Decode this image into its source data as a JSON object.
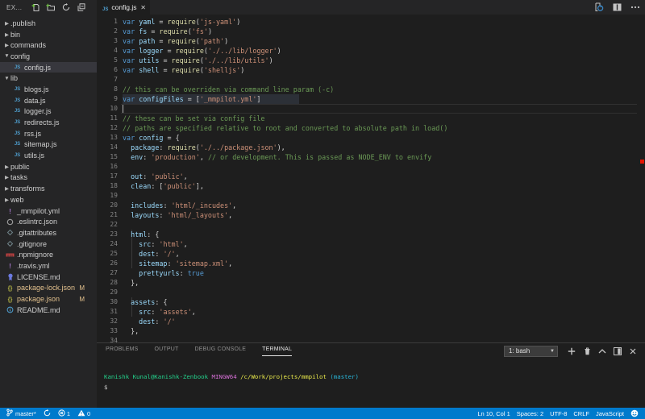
{
  "sidebar": {
    "title": "EX...",
    "actions": [
      {
        "name": "new-file",
        "icon": "new-file-icon"
      },
      {
        "name": "new-folder",
        "icon": "new-folder-icon"
      },
      {
        "name": "refresh",
        "icon": "refresh-icon"
      },
      {
        "name": "collapse-all",
        "icon": "collapse-all-icon"
      }
    ],
    "items": [
      {
        "label": ".publish",
        "kind": "folder",
        "state": "collapsed"
      },
      {
        "label": "bin",
        "kind": "folder",
        "state": "collapsed"
      },
      {
        "label": "commands",
        "kind": "folder",
        "state": "collapsed"
      },
      {
        "label": "config",
        "kind": "folder",
        "state": "expanded"
      },
      {
        "label": "config.js",
        "kind": "file",
        "icon": "js",
        "indent": 1,
        "selected": true
      },
      {
        "label": "lib",
        "kind": "folder",
        "state": "expanded"
      },
      {
        "label": "blogs.js",
        "kind": "file",
        "icon": "js",
        "indent": 1
      },
      {
        "label": "data.js",
        "kind": "file",
        "icon": "js",
        "indent": 1
      },
      {
        "label": "logger.js",
        "kind": "file",
        "icon": "js",
        "indent": 1
      },
      {
        "label": "redirects.js",
        "kind": "file",
        "icon": "js",
        "indent": 1
      },
      {
        "label": "rss.js",
        "kind": "file",
        "icon": "js",
        "indent": 1
      },
      {
        "label": "sitemap.js",
        "kind": "file",
        "icon": "js",
        "indent": 1
      },
      {
        "label": "utils.js",
        "kind": "file",
        "icon": "js",
        "indent": 1
      },
      {
        "label": "public",
        "kind": "folder",
        "state": "collapsed"
      },
      {
        "label": "tasks",
        "kind": "folder",
        "state": "collapsed"
      },
      {
        "label": "transforms",
        "kind": "folder",
        "state": "collapsed"
      },
      {
        "label": "web",
        "kind": "folder",
        "state": "collapsed"
      },
      {
        "label": "_mmpilot.yml",
        "kind": "file",
        "icon": "yml"
      },
      {
        "label": ".eslintrc.json",
        "kind": "file",
        "icon": "eslint"
      },
      {
        "label": ".gitattributes",
        "kind": "file",
        "icon": "git"
      },
      {
        "label": ".gitignore",
        "kind": "file",
        "icon": "git"
      },
      {
        "label": ".npmignore",
        "kind": "file",
        "icon": "npm"
      },
      {
        "label": ".travis.yml",
        "kind": "file",
        "icon": "yml"
      },
      {
        "label": "LICENSE.md",
        "kind": "file",
        "icon": "license"
      },
      {
        "label": "package-lock.json",
        "kind": "file",
        "icon": "json",
        "badge": "M",
        "modified": true
      },
      {
        "label": "package.json",
        "kind": "file",
        "icon": "json",
        "badge": "M",
        "modified": true
      },
      {
        "label": "README.md",
        "kind": "file",
        "icon": "info"
      }
    ]
  },
  "editor": {
    "tab": {
      "label": "config.js",
      "icon": "js",
      "close": "✕"
    },
    "actions": [
      {
        "name": "open-changes",
        "icon": "open-changes-icon"
      },
      {
        "name": "split-editor",
        "icon": "split-editor-icon"
      },
      {
        "name": "more-actions",
        "icon": "ellipsis-icon"
      }
    ],
    "cursor": {
      "line": 10,
      "col": 1
    },
    "code_lines": [
      {
        "n": 1,
        "tokens": [
          [
            "k",
            "var"
          ],
          [
            "p",
            " "
          ],
          [
            "v",
            "yaml"
          ],
          [
            "p",
            " = "
          ],
          [
            "f",
            "require"
          ],
          [
            "p",
            "("
          ],
          [
            "s",
            "'js-yaml'"
          ],
          [
            "p",
            ")"
          ]
        ]
      },
      {
        "n": 2,
        "tokens": [
          [
            "k",
            "var"
          ],
          [
            "p",
            " "
          ],
          [
            "v",
            "fs"
          ],
          [
            "p",
            " = "
          ],
          [
            "f",
            "require"
          ],
          [
            "p",
            "("
          ],
          [
            "s",
            "'fs'"
          ],
          [
            "p",
            ")"
          ]
        ]
      },
      {
        "n": 3,
        "tokens": [
          [
            "k",
            "var"
          ],
          [
            "p",
            " "
          ],
          [
            "v",
            "path"
          ],
          [
            "p",
            " = "
          ],
          [
            "f",
            "require"
          ],
          [
            "p",
            "("
          ],
          [
            "s",
            "'path'"
          ],
          [
            "p",
            ")"
          ]
        ]
      },
      {
        "n": 4,
        "tokens": [
          [
            "k",
            "var"
          ],
          [
            "p",
            " "
          ],
          [
            "v",
            "logger"
          ],
          [
            "p",
            " = "
          ],
          [
            "f",
            "require"
          ],
          [
            "p",
            "("
          ],
          [
            "s",
            "'./../lib/logger'"
          ],
          [
            "p",
            ")"
          ]
        ]
      },
      {
        "n": 5,
        "tokens": [
          [
            "k",
            "var"
          ],
          [
            "p",
            " "
          ],
          [
            "v",
            "utils"
          ],
          [
            "p",
            " = "
          ],
          [
            "f",
            "require"
          ],
          [
            "p",
            "("
          ],
          [
            "s",
            "'./../lib/utils'"
          ],
          [
            "p",
            ")"
          ]
        ]
      },
      {
        "n": 6,
        "tokens": [
          [
            "k",
            "var"
          ],
          [
            "p",
            " "
          ],
          [
            "v",
            "shell"
          ],
          [
            "p",
            " = "
          ],
          [
            "f",
            "require"
          ],
          [
            "p",
            "("
          ],
          [
            "s",
            "'shelljs'"
          ],
          [
            "p",
            ")"
          ]
        ]
      },
      {
        "n": 7,
        "tokens": []
      },
      {
        "n": 8,
        "tokens": [
          [
            "c",
            "// this can be overriden via command line param (-c)"
          ]
        ]
      },
      {
        "n": 9,
        "tokens": [
          [
            "k",
            "var"
          ],
          [
            "p",
            " "
          ],
          [
            "v",
            "configFiles"
          ],
          [
            "p",
            " = ["
          ],
          [
            "s",
            "'_mmpilot.yml'"
          ],
          [
            "p",
            "]"
          ]
        ]
      },
      {
        "n": 10,
        "tokens": []
      },
      {
        "n": 11,
        "tokens": [
          [
            "c",
            "// these can be set via config file"
          ]
        ]
      },
      {
        "n": 12,
        "tokens": [
          [
            "c",
            "// paths are specified relative to root and converted to absolute path in load()"
          ]
        ]
      },
      {
        "n": 13,
        "tokens": [
          [
            "k",
            "var"
          ],
          [
            "p",
            " "
          ],
          [
            "v",
            "config"
          ],
          [
            "p",
            " = {"
          ]
        ]
      },
      {
        "n": 14,
        "tokens": [
          [
            "p",
            "  "
          ],
          [
            "v",
            "package"
          ],
          [
            "p",
            ": "
          ],
          [
            "f",
            "require"
          ],
          [
            "p",
            "("
          ],
          [
            "s",
            "'./../package.json'"
          ],
          [
            "p",
            "),"
          ]
        ]
      },
      {
        "n": 15,
        "tokens": [
          [
            "p",
            "  "
          ],
          [
            "v",
            "env"
          ],
          [
            "p",
            ": "
          ],
          [
            "s",
            "'production'"
          ],
          [
            "p",
            ", "
          ],
          [
            "c",
            "// or development. This is passed as NODE_ENV to envify"
          ]
        ]
      },
      {
        "n": 16,
        "tokens": []
      },
      {
        "n": 17,
        "tokens": [
          [
            "p",
            "  "
          ],
          [
            "v",
            "out"
          ],
          [
            "p",
            ": "
          ],
          [
            "s",
            "'public'"
          ],
          [
            "p",
            ","
          ]
        ]
      },
      {
        "n": 18,
        "tokens": [
          [
            "p",
            "  "
          ],
          [
            "v",
            "clean"
          ],
          [
            "p",
            ": ["
          ],
          [
            "s",
            "'public'"
          ],
          [
            "p",
            "],"
          ]
        ]
      },
      {
        "n": 19,
        "tokens": []
      },
      {
        "n": 20,
        "tokens": [
          [
            "p",
            "  "
          ],
          [
            "v",
            "includes"
          ],
          [
            "p",
            ": "
          ],
          [
            "s",
            "'html/_incudes'"
          ],
          [
            "p",
            ","
          ]
        ]
      },
      {
        "n": 21,
        "tokens": [
          [
            "p",
            "  "
          ],
          [
            "v",
            "layouts"
          ],
          [
            "p",
            ": "
          ],
          [
            "s",
            "'html/_layouts'"
          ],
          [
            "p",
            ","
          ]
        ]
      },
      {
        "n": 22,
        "tokens": []
      },
      {
        "n": 23,
        "tokens": [
          [
            "p",
            "  "
          ],
          [
            "v",
            "html"
          ],
          [
            "p",
            ": {"
          ]
        ]
      },
      {
        "n": 24,
        "tokens": [
          [
            "p",
            "    "
          ],
          [
            "v",
            "src"
          ],
          [
            "p",
            ": "
          ],
          [
            "s",
            "'html'"
          ],
          [
            "p",
            ","
          ]
        ]
      },
      {
        "n": 25,
        "tokens": [
          [
            "p",
            "    "
          ],
          [
            "v",
            "dest"
          ],
          [
            "p",
            ": "
          ],
          [
            "s",
            "'/'"
          ],
          [
            "p",
            ","
          ]
        ]
      },
      {
        "n": 26,
        "tokens": [
          [
            "p",
            "    "
          ],
          [
            "v",
            "sitemap"
          ],
          [
            "p",
            ": "
          ],
          [
            "s",
            "'sitemap.xml'"
          ],
          [
            "p",
            ","
          ]
        ]
      },
      {
        "n": 27,
        "tokens": [
          [
            "p",
            "    "
          ],
          [
            "v",
            "prettyurls"
          ],
          [
            "p",
            ": "
          ],
          [
            "k",
            "true"
          ]
        ]
      },
      {
        "n": 28,
        "tokens": [
          [
            "p",
            "  },"
          ]
        ]
      },
      {
        "n": 29,
        "tokens": []
      },
      {
        "n": 30,
        "tokens": [
          [
            "p",
            "  "
          ],
          [
            "v",
            "assets"
          ],
          [
            "p",
            ": {"
          ]
        ]
      },
      {
        "n": 31,
        "tokens": [
          [
            "p",
            "    "
          ],
          [
            "v",
            "src"
          ],
          [
            "p",
            ": "
          ],
          [
            "s",
            "'assets'"
          ],
          [
            "p",
            ","
          ]
        ]
      },
      {
        "n": 32,
        "tokens": [
          [
            "p",
            "    "
          ],
          [
            "v",
            "dest"
          ],
          [
            "p",
            ": "
          ],
          [
            "s",
            "'/'"
          ]
        ]
      },
      {
        "n": 33,
        "tokens": [
          [
            "p",
            "  },"
          ]
        ]
      },
      {
        "n": 34,
        "tokens": []
      }
    ]
  },
  "panel": {
    "tabs": [
      {
        "label": "PROBLEMS",
        "active": false
      },
      {
        "label": "OUTPUT",
        "active": false
      },
      {
        "label": "DEBUG CONSOLE",
        "active": false
      },
      {
        "label": "TERMINAL",
        "active": true
      }
    ],
    "terminal_select": "1: bash",
    "toolbar": [
      {
        "name": "new-terminal",
        "icon": "plus-icon"
      },
      {
        "name": "kill-terminal",
        "icon": "trash-icon"
      },
      {
        "name": "maximize-panel",
        "icon": "chevron-up-icon"
      },
      {
        "name": "move-panel",
        "icon": "split-panel-icon"
      },
      {
        "name": "close-panel",
        "icon": "close-icon"
      }
    ],
    "prompt": [
      {
        "color": "green",
        "text": "Kanishk Kunal@Kanishk-Zenbook"
      },
      {
        "color": "def",
        "text": " "
      },
      {
        "color": "mag",
        "text": "MINGW64"
      },
      {
        "color": "def",
        "text": " "
      },
      {
        "color": "yel",
        "text": "/c/Work/projects/mmpilot"
      },
      {
        "color": "def",
        "text": " "
      },
      {
        "color": "cyan",
        "text": "(master)"
      }
    ],
    "prompt_line2": "$"
  },
  "statusbar": {
    "branch": "master*",
    "errors": "1",
    "warnings": "0",
    "right_items": [
      "Ln 10, Col 1",
      "Spaces: 2",
      "UTF-8",
      "CRLF",
      "JavaScript"
    ]
  },
  "colors": {
    "accent_statusbar": "#007acc",
    "editor_bg": "#1e1e1e",
    "sidebar_bg": "#252526",
    "git_modified": "#e2c08d",
    "error_marker": "#e51400"
  }
}
